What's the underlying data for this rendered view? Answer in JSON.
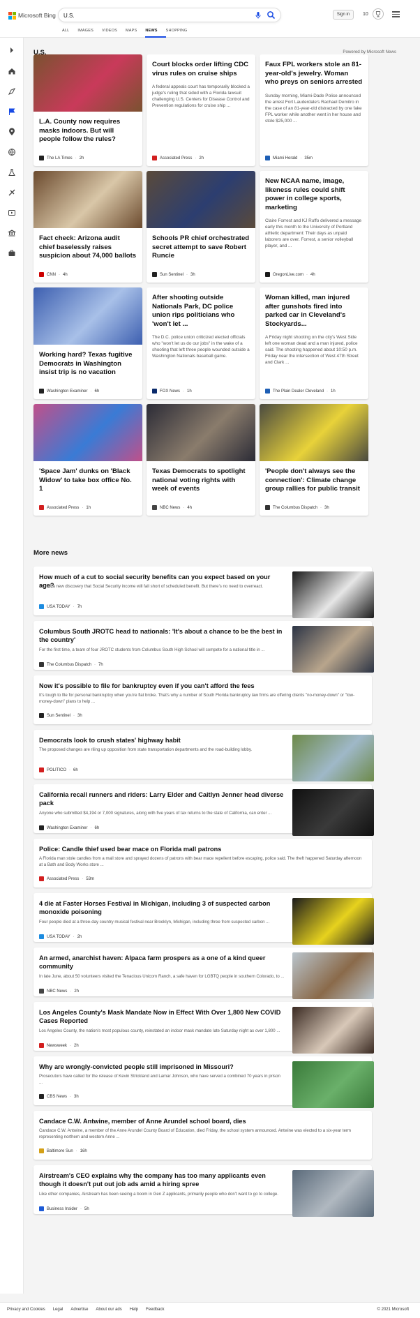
{
  "header": {
    "brand": "Microsoft Bing",
    "search_value": "U.S.",
    "sign_in": "Sign in",
    "rewards_count": "10",
    "scopes": [
      "ALL",
      "IMAGES",
      "VIDEOS",
      "MAPS",
      "NEWS",
      "SHOPPING"
    ],
    "active_scope": "NEWS"
  },
  "rail_icons": [
    "expand-arrow-icon",
    "home-icon",
    "discover-icon",
    "us-flag-icon",
    "location-icon",
    "world-icon",
    "science-icon",
    "sports-icon",
    "entertainment-icon",
    "politics-icon",
    "business-icon"
  ],
  "section": {
    "title": "U.S.",
    "powered": "Powered by Microsoft News"
  },
  "cards": [
    {
      "title": "L.A. County now requires masks indoors. But will people follow the rules?",
      "summary": "",
      "provider": "The LA Times",
      "time": "2h",
      "img": true,
      "logo": "#222222",
      "c1": "#7a5230",
      "c2": "#c93a5a"
    },
    {
      "title": "Court blocks order lifting CDC virus rules on cruise ships",
      "summary": "A federal appeals court has temporarily blocked a judge's ruling that sided with a Florida lawsuit challenging U.S. Centers for Disease Control and Prevention regulations for cruise ship ...",
      "provider": "Associated Press",
      "time": "2h",
      "img": false,
      "logo": "#d21f1f"
    },
    {
      "title": "Faux FPL workers stole an 81-year-old's jewelry. Woman who preys on seniors arrested",
      "summary": "Sunday morning, Miami-Dade Police announced the arrest Fort Lauderdale's Rachael Demitro in the case of an 81-year-old distracted by one fake FPL worker while another went in her house and stole $25,000 ...",
      "provider": "Miami Herald",
      "time": "35m",
      "img": false,
      "logo": "#1e5fb5"
    },
    {
      "title": "Fact check: Arizona audit chief baselessly raises suspicion about 74,000 ballots",
      "summary": "",
      "provider": "CNN",
      "time": "4h",
      "img": true,
      "logo": "#cc0000",
      "c1": "#6b4a2e",
      "c2": "#d9c7a8"
    },
    {
      "title": "Schools PR chief orchestrated secret attempt to save Robert Runcie",
      "summary": "",
      "provider": "Sun Sentinel",
      "time": "3h",
      "img": true,
      "logo": "#222222",
      "c1": "#5a4a3a",
      "c2": "#2c3e70"
    },
    {
      "title": "New NCAA name, image, likeness rules could shift power in college sports, marketing",
      "summary": "Claire Forrest and KJ Ruffo delivered a message early this month to the University of Portland athletic department: Their days as unpaid laborers are over. Forrest, a senior volleyball player, and ...",
      "provider": "OregonLive.com",
      "time": "4h",
      "img": false,
      "logo": "#1a1a1a"
    },
    {
      "title": "Working hard? Texas fugitive Democrats in Washington insist trip is no vacation",
      "summary": "",
      "provider": "Washington Examiner",
      "time": "6h",
      "img": true,
      "logo": "#222222",
      "c1": "#3d5fb0",
      "c2": "#a8c0e8"
    },
    {
      "title": "After shooting outside Nationals Park, DC police union rips politicians who 'won't let ...",
      "summary": "The D.C. police union criticized elected officials who \"won't let us do our jobs\" in the wake of a shooting that left three people wounded outside a Washington Nationals baseball game.",
      "provider": "FOX News",
      "time": "1h",
      "img": false,
      "logo": "#0a2a6b"
    },
    {
      "title": "Woman killed, man injured after gunshots fired into parked car in Cleveland's Stockyards...",
      "summary": "A Friday night shooting on the city's West Side left one woman dead and a man injured, police said. The shooting happened about 10:50 p.m. Friday near the intersection of West 47th Street and Clark ...",
      "provider": "The Plain Dealer Cleveland",
      "time": "1h",
      "img": false,
      "logo": "#1e5fb5"
    },
    {
      "title": "'Space Jam' dunks on 'Black Widow' to take box office No. 1",
      "summary": "",
      "provider": "Associated Press",
      "time": "1h",
      "img": true,
      "logo": "#d21f1f",
      "c1": "#c0508a",
      "c2": "#3a7bd5"
    },
    {
      "title": "Texas Democrats to spotlight national voting rights with week of events",
      "summary": "",
      "provider": "NBC News",
      "time": "4h",
      "img": true,
      "logo": "#444444",
      "c1": "#2b2b36",
      "c2": "#8a7c6c"
    },
    {
      "title": "'People don't always see the connection': Climate change group rallies for public transit",
      "summary": "",
      "provider": "The Columbus Dispatch",
      "time": "3h",
      "img": true,
      "logo": "#333333",
      "c1": "#4a4a40",
      "c2": "#e8d23a"
    }
  ],
  "more": {
    "title": "More news",
    "items": [
      {
        "title": "How much of a cut to social security benefits can you expect based on your age?",
        "summary": "It's not a new discovery that Social Security income will fall short of scheduled benefit. But there's no need to overreact.",
        "provider": "USA TODAY",
        "time": "7h",
        "img": true,
        "logo": "#1d8ce0",
        "c1": "#1a1a1a",
        "c2": "#e6e6e6"
      },
      {
        "title": "Columbus South JROTC head to nationals: 'It's about a chance to be the best in the country'",
        "summary": "For the first time, a team of four JROTC students from Columbus South High School will compete for a national title in ...",
        "provider": "The Columbus Dispatch",
        "time": "7h",
        "img": true,
        "logo": "#333333",
        "c1": "#2c3445",
        "c2": "#b8a58c"
      },
      {
        "title": "Now it's possible to file for bankruptcy even if you can't afford the fees",
        "summary": "It's tough to file for personal bankruptcy when you're flat broke. That's why a number of South Florida bankruptcy law firms are offering clients \"no-money-down\" or \"low-money-down\" plans to help ...",
        "provider": "Sun Sentinel",
        "time": "3h",
        "img": false,
        "logo": "#222222"
      },
      {
        "title": "Democrats look to crush states' highway habit",
        "summary": "The proposed changes are riling up opposition from state transportation departments and the road-building lobby.",
        "provider": "POLITICO",
        "time": "6h",
        "img": true,
        "logo": "#d21f1f",
        "c1": "#6d8a4a",
        "c2": "#9fb8c8"
      },
      {
        "title": "California recall runners and riders: Larry Elder and Caitlyn Jenner head diverse pack",
        "summary": "Anyone who submitted $4,194 or 7,000 signatures, along with five years of tax returns to the state of California, can enter ...",
        "provider": "Washington Examiner",
        "time": "6h",
        "img": true,
        "logo": "#222222",
        "c1": "#101010",
        "c2": "#3a3a3a"
      },
      {
        "title": "Police: Candle thief used bear mace on Florida mall patrons",
        "summary": "A Florida man stole candles from a mall store and sprayed dozens of patrons with bear mace repellent before escaping, police said. The theft happened Saturday afternoon at a Bath and Body Works store ...",
        "provider": "Associated Press",
        "time": "53m",
        "img": false,
        "logo": "#d21f1f"
      },
      {
        "title": "4 die at Faster Horses Festival in Michigan, including 3 of suspected carbon monoxide poisoning",
        "summary": "Four people died at a three-day country musical festival near Brooklyn, Michigan, including three from suspected carbon ...",
        "provider": "USA TODAY",
        "time": "2h",
        "img": true,
        "logo": "#1d8ce0",
        "c1": "#1b1b1b",
        "c2": "#e7d21e"
      },
      {
        "title": "An armed, anarchist haven: Alpaca farm prospers as a one of a kind queer community",
        "summary": "In late June, about 50 volunteers visited the Tenacious Unicorn Ranch, a safe haven for LGBTQ people in southern Colorado, to ...",
        "provider": "NBC News",
        "time": "2h",
        "img": true,
        "logo": "#444444",
        "c1": "#b9c4cc",
        "c2": "#8a6a4a"
      },
      {
        "title": "Los Angeles County's Mask Mandate Now in Effect With Over 1,800 New COVID Cases Reported",
        "summary": "Los Angeles County, the nation's most populous county, reinstated an indoor mask mandate late Saturday night as over 1,800 ...",
        "provider": "Newsweek",
        "time": "2h",
        "img": true,
        "logo": "#d21f1f",
        "c1": "#3a2a22",
        "c2": "#d8c8b8"
      },
      {
        "title": "Why are wrongly-convicted people still imprisoned in Missouri?",
        "summary": "Prosecutors have called for the release of Kevin Strickland and Lamar Johnson, who have served a combined 70 years in prison ...",
        "provider": "CBS News",
        "time": "3h",
        "img": true,
        "logo": "#222222",
        "c1": "#3a7a3a",
        "c2": "#6ab06a"
      },
      {
        "title": "Candace C.W. Antwine, member of Anne Arundel school board, dies",
        "summary": "Candace C.W. Antwine, a member of the Anne Arundel County Board of Education, died Friday, the school system announced. Antwine was elected to a six-year term representing northern and western Anne ...",
        "provider": "Baltimore Sun",
        "time": "16h",
        "img": false,
        "logo": "#d4a017"
      },
      {
        "title": "Airstream's CEO explains why the company has too many applicants even though it doesn't put out job ads amid a hiring spree",
        "summary": "Like other companies, Airstream has been seeing a boom in Gen Z applicants, primarily people who don't want to go to college.",
        "provider": "Business Insider",
        "time": "5h",
        "img": true,
        "logo": "#1d5bd6",
        "c1": "#5a6a7a",
        "c2": "#b0b8c0"
      }
    ]
  },
  "footer": {
    "links": [
      "Privacy and Cookies",
      "Legal",
      "Advertise",
      "About our ads",
      "Help",
      "Feedback"
    ],
    "copyright": "© 2021 Microsoft"
  },
  "colors": {
    "accent": "#174ae4",
    "bing_red": "#f25022",
    "bing_green": "#7fba00",
    "bing_blue": "#00a4ef",
    "bing_yellow": "#ffb900"
  }
}
